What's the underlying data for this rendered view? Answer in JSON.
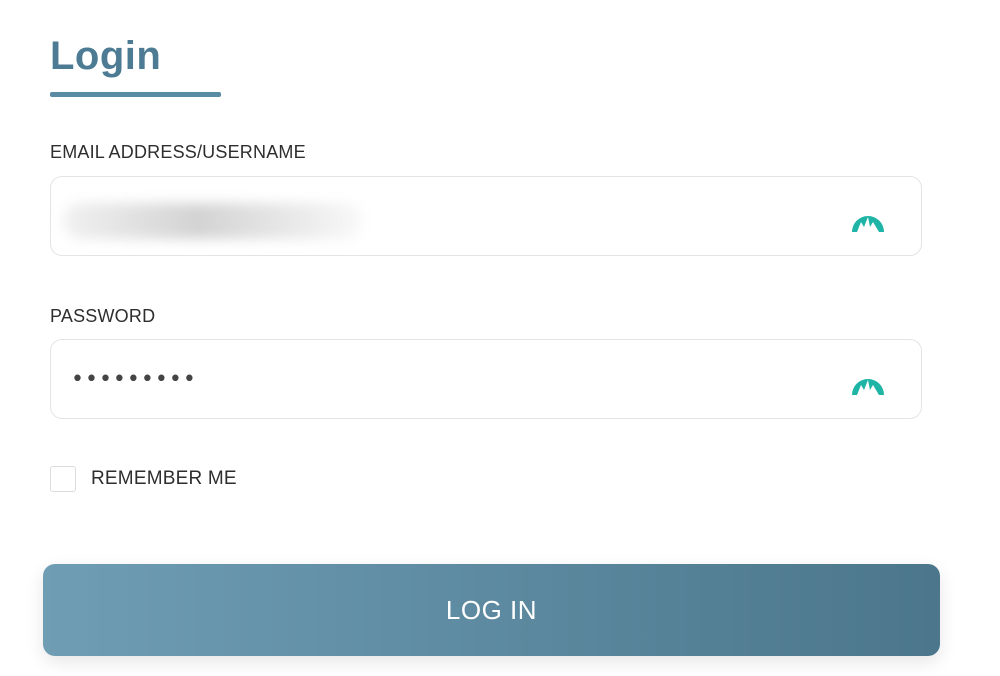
{
  "form": {
    "title": "Login",
    "email": {
      "label": "EMAIL ADDRESS/USERNAME",
      "icon": "password-manager-icon"
    },
    "password": {
      "label": "PASSWORD",
      "value": "•••••••••",
      "icon": "password-manager-icon"
    },
    "remember": {
      "label": "REMEMBER ME",
      "checked": false
    },
    "submit_label": "LOG IN"
  },
  "colors": {
    "accent": "#4c7b93",
    "icon": "#1fb5a6",
    "button_start": "#6f9db3",
    "button_end": "#4b768c"
  }
}
